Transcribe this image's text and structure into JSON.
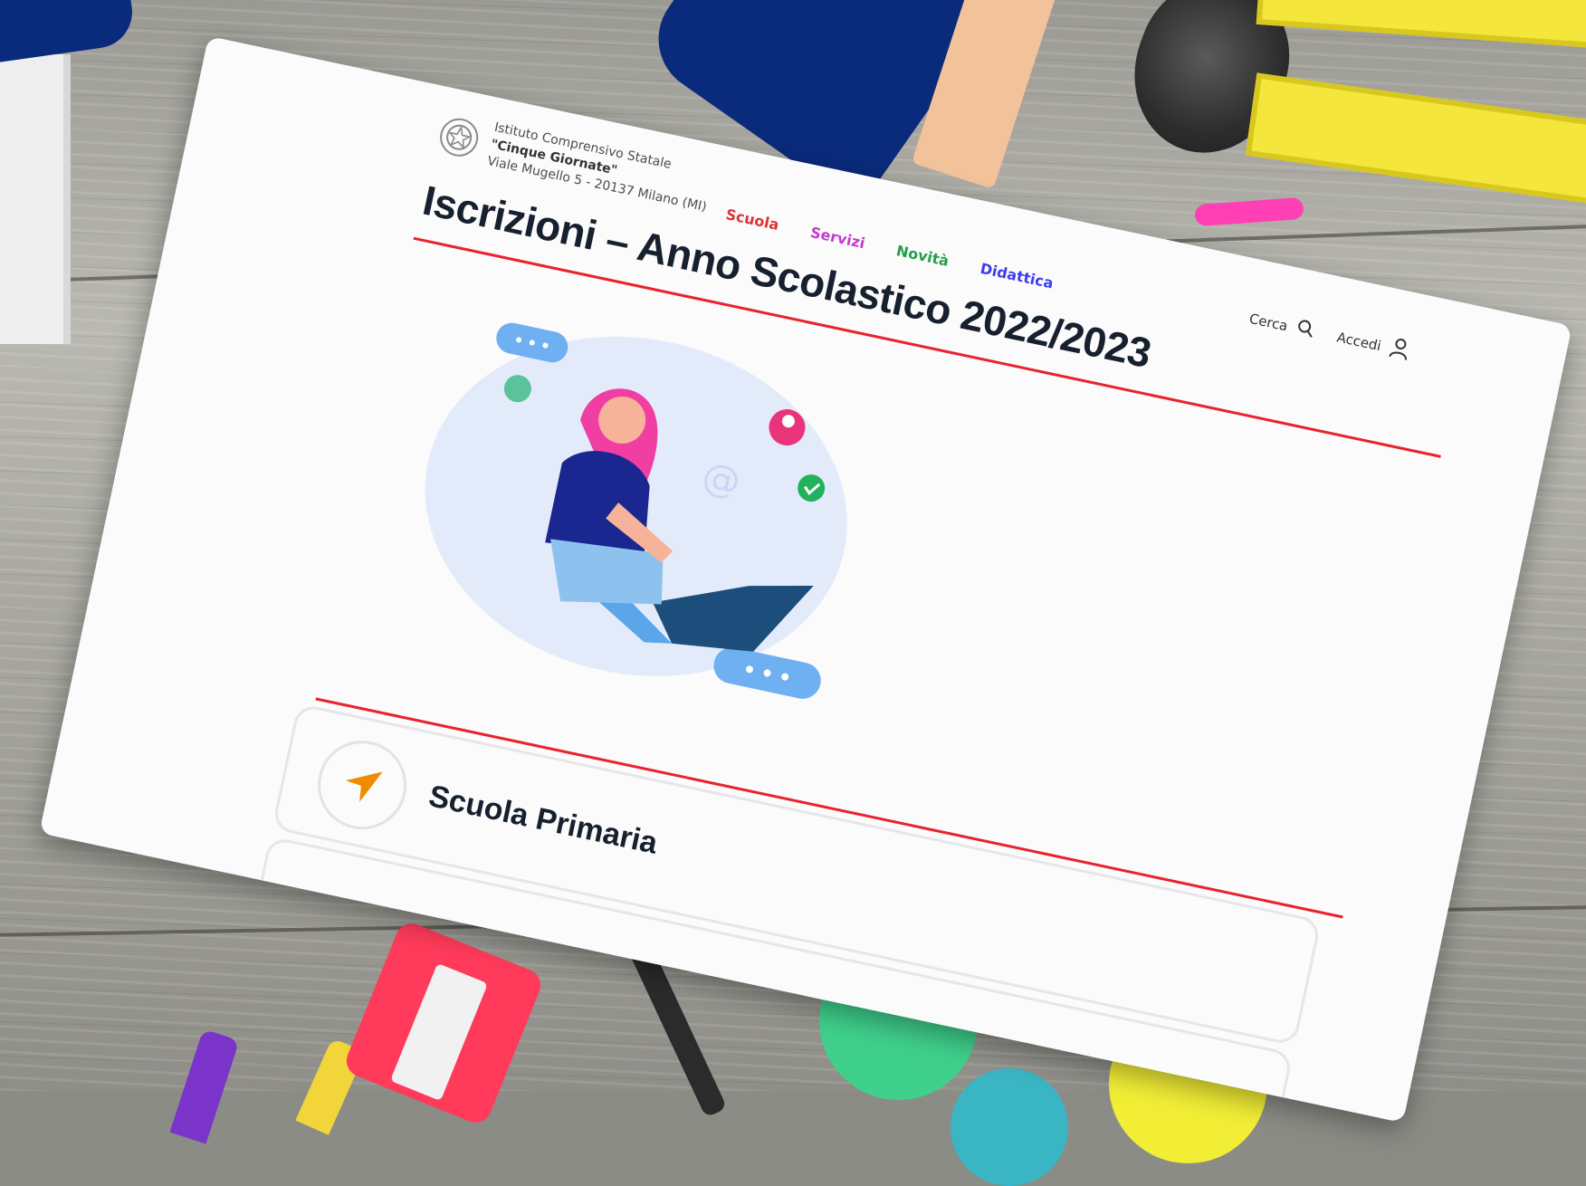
{
  "school": {
    "line1": "Istituto Comprensivo Statale",
    "name": "\"Cinque Giornate\"",
    "address": "Viale Mugello 5 - 20137 Milano (MI)"
  },
  "nav": {
    "items": [
      {
        "label": "Scuola",
        "color": "#e0303a"
      },
      {
        "label": "Servizi",
        "color": "#c43bd1"
      },
      {
        "label": "Novità",
        "color": "#22a04a"
      },
      {
        "label": "Didattica",
        "color": "#3c3cf0"
      }
    ]
  },
  "actions": {
    "search_label": "Cerca",
    "search_icon": "search-icon",
    "login_label": "Accedi",
    "login_icon": "user-icon"
  },
  "page": {
    "title": "Iscrizioni – Anno Scolastico 2022/2023",
    "accent_color": "#e8232d"
  },
  "cards": [
    {
      "title": "Scuola Primaria",
      "icon": "send-arrow-icon",
      "icon_color": "#f08a00"
    }
  ]
}
